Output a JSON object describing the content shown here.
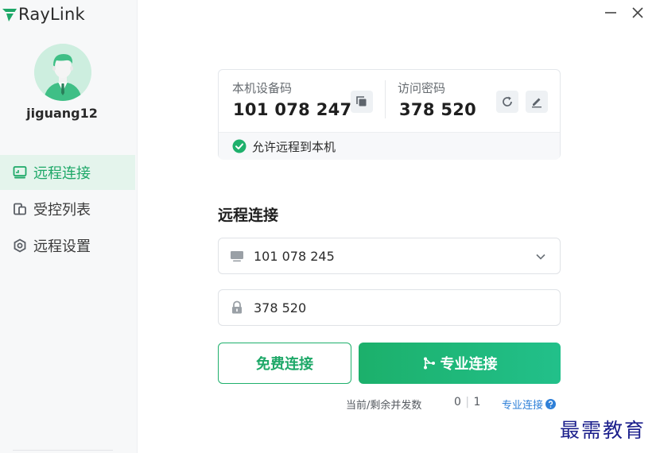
{
  "app": {
    "name": "RayLink",
    "brand_color": "#1ea868"
  },
  "user": {
    "name": "jiguang12"
  },
  "sidebar": {
    "items": [
      {
        "label": "远程连接",
        "icon": "monitor-icon",
        "active": true
      },
      {
        "label": "受控列表",
        "icon": "device-list-icon",
        "active": false
      },
      {
        "label": "远程设置",
        "icon": "settings-hexagon-icon",
        "active": false
      }
    ]
  },
  "device": {
    "code_label": "本机设备码",
    "code_value": "101 078 247",
    "password_label": "访问密码",
    "password_value": "378 520",
    "allow_text": "允许远程到本机"
  },
  "connect": {
    "title": "远程连接",
    "device_field_value": "101 078 245",
    "password_field_value": "378 520",
    "free_button": "免费连接",
    "pro_button": "专业连接"
  },
  "footer": {
    "concurrency_label": "当前/剩余并发数",
    "current": "0",
    "separator": "|",
    "remaining": "1",
    "pro_link": "专业连接"
  },
  "watermark": "最需教育"
}
